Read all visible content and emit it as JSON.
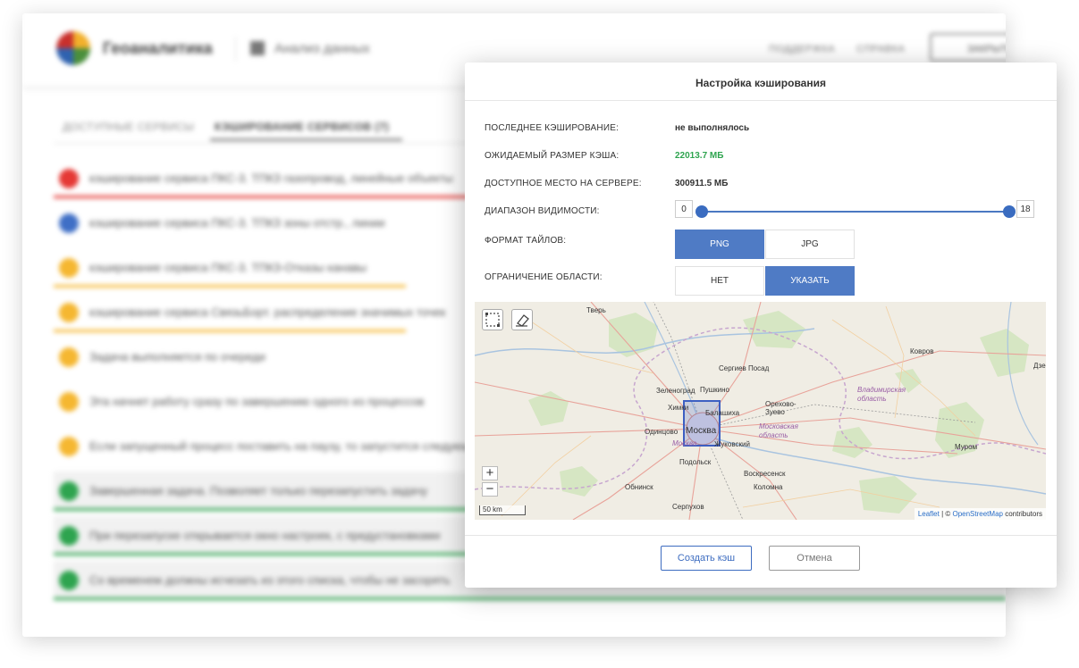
{
  "app": {
    "brand": "Геоаналитика",
    "section": "Анализ данных",
    "top_links": [
      "ПОДДЕРЖКА",
      "СПРАВКА"
    ],
    "top_button": "ЗАКРЫТЬ",
    "tabs": [
      {
        "label": "ДОСТУПНЫЕ СЕРВИСЫ"
      },
      {
        "label": "КЭШИРОВАНИЕ СЕРВИСОВ (7)"
      }
    ],
    "tasks": [
      {
        "text": "кэширование сервиса ПКС-3. ТПКЗ газопровод, линейные объекты",
        "color": "#e53935"
      },
      {
        "text": "кэширование сервиса ПКС-3. ТПКЗ зоны отстр., линии",
        "color": "#3f6fc6"
      },
      {
        "text": "кэширование сервиса ПКС-3. ТПКЗ-Отказы канавы",
        "color": "#f5b731"
      },
      {
        "text": "кэширование сервиса СвязьБорт. распределение значимых точек",
        "color": "#f5b731"
      },
      {
        "text": "Задача выполняется по очереди",
        "color": "#f5b731"
      },
      {
        "text": "Эта начнет работу сразу по завершению одного из процессов",
        "color": "#f5b731"
      },
      {
        "text": "Если запущенный процесс поставить на паузу, то запустится следующий",
        "color": "#f5b731"
      },
      {
        "text": "Завершенная задача. Позволяет только перезапустить задачу",
        "color": "#2ea44f"
      },
      {
        "text": "При перезапуске открывается окно настроек, с предустановками",
        "color": "#2ea44f"
      },
      {
        "text": "Со временем должны исчезать из этого списка, чтобы не засорять",
        "color": "#2ea44f"
      }
    ]
  },
  "modal": {
    "title": "Настройка кэширования",
    "last_cache": {
      "label": "ПОСЛЕДНЕЕ КЭШИРОВАНИЕ:",
      "value": "не выполнялось"
    },
    "expected_size": {
      "label": "ОЖИДАЕМЫЙ РАЗМЕР КЭША:",
      "value": "22013.7 МБ"
    },
    "free_space": {
      "label": "ДОСТУПНОЕ МЕСТО НА СЕРВЕРЕ:",
      "value": "300911.5 МБ"
    },
    "visibility": {
      "label": "ДИАПАЗОН ВИДИМОСТИ:",
      "min": "0",
      "max": "18"
    },
    "tile_format": {
      "label": "ФОРМАТ ТАЙЛОВ:",
      "options": [
        "PNG",
        "JPG"
      ],
      "selected": "PNG"
    },
    "area_limit": {
      "label": "ОГРАНИЧЕНИЕ ОБЛАСТИ:",
      "options": [
        "НЕТ",
        "УКАЗАТЬ"
      ],
      "selected": "УКАЗАТЬ"
    },
    "map": {
      "places": [
        "Тверь",
        "Сергиев Посад",
        "Ковров",
        "Дзер",
        "Зеленоград",
        "Пушкино",
        "Химки",
        "Балашиха",
        "Орехово-Зуево",
        "Одинцово",
        "Москва",
        "Жуковский",
        "Подольск",
        "Воскресенск",
        "Коломна",
        "Обнинск",
        "Серпухов",
        "Муром"
      ],
      "regions": [
        "Владимирская область",
        "Московская область",
        "Москва"
      ],
      "scale": "50 km",
      "attribution": {
        "leaflet": "Leaflet",
        "sep": " | © ",
        "osm": "OpenStreetMap",
        "rest": " contributors"
      }
    },
    "buttons": {
      "create": "Создать кэш",
      "cancel": "Отмена"
    }
  }
}
